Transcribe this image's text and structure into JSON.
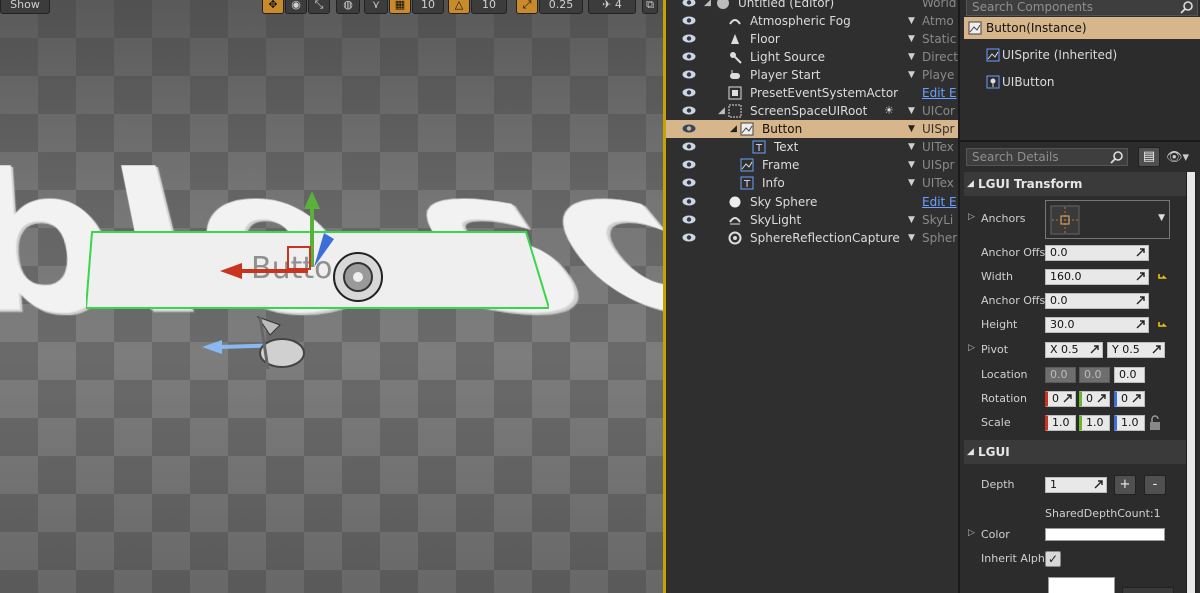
{
  "viewport": {
    "toolbar": {
      "show_label": "Show",
      "grid_snap": "10",
      "rot_snap": "10",
      "scale_snap": "0.25",
      "cam_speed": "4"
    },
    "scene_text": "ble scre",
    "button_text": "Butto"
  },
  "outliner": {
    "rows": [
      {
        "label": "Untitled (Editor)",
        "type": "World"
      },
      {
        "label": "Atmospheric Fog",
        "type": "Atmo"
      },
      {
        "label": "Floor",
        "type": "Static"
      },
      {
        "label": "Light Source",
        "type": "Direct"
      },
      {
        "label": "Player Start",
        "type": "Playe"
      },
      {
        "label": "PresetEventSystemActor",
        "type": "Edit E"
      },
      {
        "label": "ScreenSpaceUIRoot",
        "type": "UICor"
      },
      {
        "label": "Button",
        "type": "UISpr"
      },
      {
        "label": "Text",
        "type": "UITex"
      },
      {
        "label": "Frame",
        "type": "UISpr"
      },
      {
        "label": "Info",
        "type": "UITex"
      },
      {
        "label": "Sky Sphere",
        "type": "Edit E"
      },
      {
        "label": "SkyLight",
        "type": "SkyLi"
      },
      {
        "label": "SphereReflectionCapture",
        "type": "Spher"
      }
    ]
  },
  "details": {
    "search_components_placeholder": "Search Components",
    "components": [
      {
        "label": "Button(Instance)"
      },
      {
        "label": "UISprite (Inherited)"
      },
      {
        "label": "UIButton"
      }
    ],
    "search_details_placeholder": "Search Details",
    "lgui_transform": {
      "title": "LGUI Transform",
      "anchors_label": "Anchors",
      "anchor_offs_label_1": "Anchor Offs",
      "anchor_offs_value_1": "0.0",
      "width_label": "Width",
      "width_value": "160.0",
      "anchor_offs_label_2": "Anchor Offs",
      "anchor_offs_value_2": "0.0",
      "height_label": "Height",
      "height_value": "30.0",
      "pivot_label": "Pivot",
      "pivot_x": "X  0.5",
      "pivot_y": "Y  0.5",
      "location_label": "Location",
      "location": [
        "0.0",
        "0.0",
        "0.0"
      ],
      "rotation_label": "Rotation",
      "rotation": [
        "0",
        "0",
        "0"
      ],
      "scale_label": "Scale",
      "scale": [
        "1.0",
        "1.0",
        "1.0"
      ]
    },
    "lgui": {
      "title": "LGUI",
      "depth_label": "Depth",
      "depth_value": "1",
      "plus": "+",
      "minus": "-",
      "shared_depth": "SharedDepthCount:1",
      "color_label": "Color",
      "inherit_alpha_label": "Inherit Alpha"
    }
  }
}
